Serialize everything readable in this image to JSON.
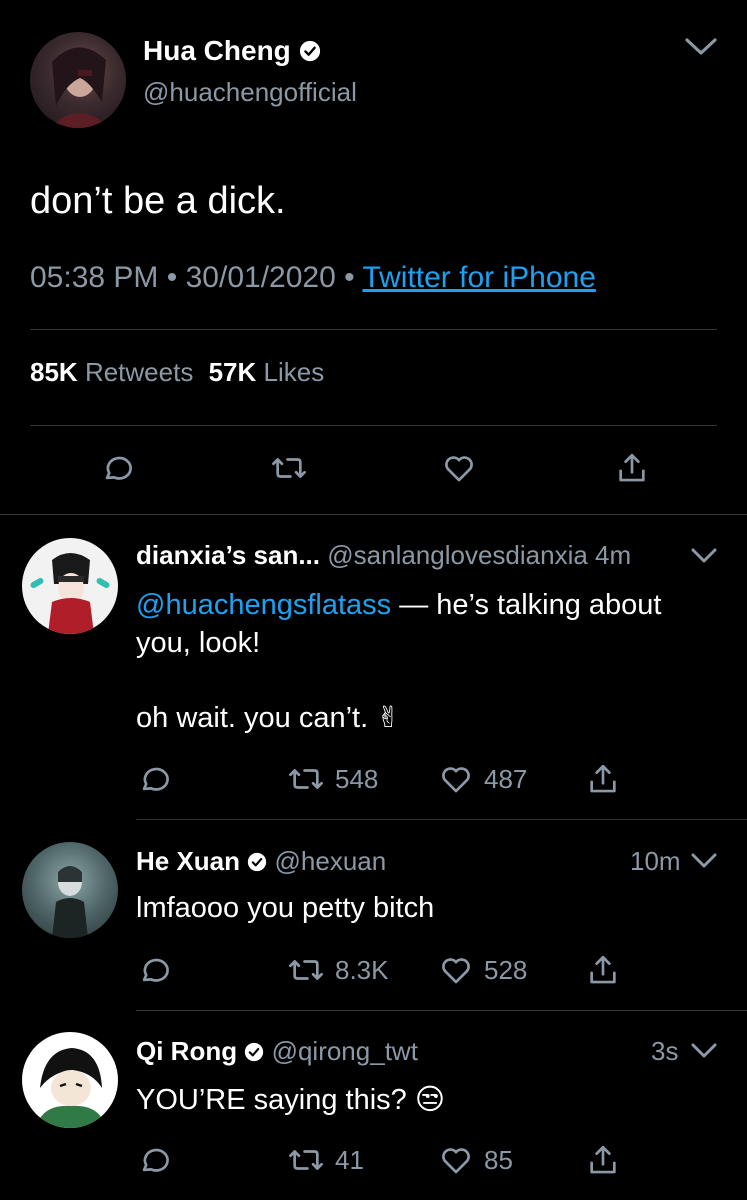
{
  "main_tweet": {
    "author_name": "Hua Cheng",
    "author_handle": "@huachengofficial",
    "text": "don’t be a dick.",
    "time": "05:38 PM",
    "date": "30/01/2020",
    "source": "Twitter for iPhone",
    "retweets_count": "85K",
    "retweets_label": "Retweets",
    "likes_count": "57K",
    "likes_label": "Likes"
  },
  "replies": [
    {
      "author_name": "dianxia’s san...",
      "author_handle": "@sanlanglovesdianxia",
      "time": "4m",
      "mention": "@huachengsflatass",
      "text_after_mention": " — he’s talking about you, look!",
      "text_line2": "oh wait. you can’t. ✌",
      "retweets": "548",
      "likes": "487"
    },
    {
      "author_name": "He Xuan",
      "author_handle": "@hexuan",
      "time": "10m",
      "text": "lmfaooo you petty bitch",
      "retweets": "8.3K",
      "likes": "528"
    },
    {
      "author_name": "Qi Rong",
      "author_handle": "@qirong_twt",
      "time": "3s",
      "text": "YOU’RE saying this? 😒",
      "retweets": "41",
      "likes": "85"
    }
  ],
  "colors": {
    "background": "#000000",
    "text": "#ffffff",
    "muted": "#8b98a5",
    "link": "#1da1f2",
    "divider": "#2f3336"
  }
}
